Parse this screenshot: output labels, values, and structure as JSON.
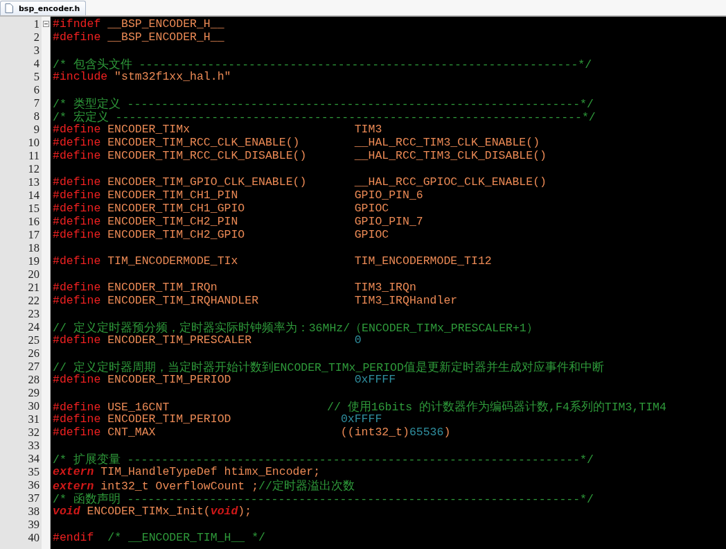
{
  "tab": {
    "label": "bsp_encoder.h",
    "selected": true
  },
  "lines": [
    {
      "number": "1",
      "fold_start": true,
      "tokens": [
        {
          "kind": "pp",
          "text": "#ifndef"
        },
        {
          "kind": "id",
          "text": " __BSP_ENCODER_H__"
        }
      ]
    },
    {
      "number": "2",
      "fold_start": false,
      "tokens": [
        {
          "kind": "pp",
          "text": "#define"
        },
        {
          "kind": "id",
          "text": " __BSP_ENCODER_H__"
        }
      ]
    },
    {
      "number": "3",
      "fold_start": false
    },
    {
      "number": "4",
      "fold_start": false,
      "tokens": [
        {
          "kind": "cm",
          "text": "/* 包含头文件 ----------------------------------------------------------------*/"
        }
      ]
    },
    {
      "number": "5",
      "fold_start": false,
      "tokens": [
        {
          "kind": "pp",
          "text": "#include"
        },
        {
          "kind": "id",
          "text": " \"stm32f1xx_hal.h\""
        }
      ]
    },
    {
      "number": "6",
      "fold_start": false
    },
    {
      "number": "7",
      "fold_start": false,
      "tokens": [
        {
          "kind": "cm",
          "text": "/* 类型定义 ------------------------------------------------------------------*/"
        }
      ]
    },
    {
      "number": "8",
      "fold_start": false,
      "tokens": [
        {
          "kind": "cm",
          "text": "/* 宏定义 --------------------------------------------------------------------*/"
        }
      ]
    },
    {
      "number": "9",
      "fold_start": false,
      "tokens": [
        {
          "kind": "pp",
          "text": "#define"
        },
        {
          "kind": "id",
          "text": " ENCODER_TIMx                        "
        },
        {
          "kind": "id",
          "text": "TIM3"
        }
      ]
    },
    {
      "number": "10",
      "fold_start": false,
      "tokens": [
        {
          "kind": "pp",
          "text": "#define"
        },
        {
          "kind": "id",
          "text": " ENCODER_TIM_RCC_CLK_ENABLE()        "
        },
        {
          "kind": "id",
          "text": "__HAL_RCC_TIM3_CLK_ENABLE()"
        }
      ]
    },
    {
      "number": "11",
      "fold_start": false,
      "tokens": [
        {
          "kind": "pp",
          "text": "#define"
        },
        {
          "kind": "id",
          "text": " ENCODER_TIM_RCC_CLK_DISABLE()       "
        },
        {
          "kind": "id",
          "text": "__HAL_RCC_TIM3_CLK_DISABLE()"
        }
      ]
    },
    {
      "number": "12",
      "fold_start": false
    },
    {
      "number": "13",
      "fold_start": false,
      "tokens": [
        {
          "kind": "pp",
          "text": "#define"
        },
        {
          "kind": "id",
          "text": " ENCODER_TIM_GPIO_CLK_ENABLE()       "
        },
        {
          "kind": "id",
          "text": "__HAL_RCC_GPIOC_CLK_ENABLE()"
        }
      ]
    },
    {
      "number": "14",
      "fold_start": false,
      "tokens": [
        {
          "kind": "pp",
          "text": "#define"
        },
        {
          "kind": "id",
          "text": " ENCODER_TIM_CH1_PIN                 "
        },
        {
          "kind": "id",
          "text": "GPIO_PIN_6"
        }
      ]
    },
    {
      "number": "15",
      "fold_start": false,
      "tokens": [
        {
          "kind": "pp",
          "text": "#define"
        },
        {
          "kind": "id",
          "text": " ENCODER_TIM_CH1_GPIO                "
        },
        {
          "kind": "id",
          "text": "GPIOC"
        }
      ]
    },
    {
      "number": "16",
      "fold_start": false,
      "tokens": [
        {
          "kind": "pp",
          "text": "#define"
        },
        {
          "kind": "id",
          "text": " ENCODER_TIM_CH2_PIN                 "
        },
        {
          "kind": "id",
          "text": "GPIO_PIN_7"
        }
      ]
    },
    {
      "number": "17",
      "fold_start": false,
      "tokens": [
        {
          "kind": "pp",
          "text": "#define"
        },
        {
          "kind": "id",
          "text": " ENCODER_TIM_CH2_GPIO                "
        },
        {
          "kind": "id",
          "text": "GPIOC"
        }
      ]
    },
    {
      "number": "18",
      "fold_start": false
    },
    {
      "number": "19",
      "fold_start": false,
      "tokens": [
        {
          "kind": "pp",
          "text": "#define"
        },
        {
          "kind": "id",
          "text": " TIM_ENCODERMODE_TIx                 "
        },
        {
          "kind": "id",
          "text": "TIM_ENCODERMODE_TI12"
        }
      ]
    },
    {
      "number": "20",
      "fold_start": false
    },
    {
      "number": "21",
      "fold_start": false,
      "tokens": [
        {
          "kind": "pp",
          "text": "#define"
        },
        {
          "kind": "id",
          "text": " ENCODER_TIM_IRQn                    "
        },
        {
          "kind": "id",
          "text": "TIM3_IRQn"
        }
      ]
    },
    {
      "number": "22",
      "fold_start": false,
      "tokens": [
        {
          "kind": "pp",
          "text": "#define"
        },
        {
          "kind": "id",
          "text": " ENCODER_TIM_IRQHANDLER              "
        },
        {
          "kind": "id",
          "text": "TIM3_IRQHandler"
        }
      ]
    },
    {
      "number": "23",
      "fold_start": false
    },
    {
      "number": "24",
      "fold_start": false,
      "tokens": [
        {
          "kind": "cm",
          "text": "// 定义定时器预分频，定时器实际时钟频率为：36MHz/（ENCODER_TIMx_PRESCALER+1）"
        }
      ]
    },
    {
      "number": "25",
      "fold_start": false,
      "tokens": [
        {
          "kind": "pp",
          "text": "#define"
        },
        {
          "kind": "id",
          "text": " ENCODER_TIM_PRESCALER               "
        },
        {
          "kind": "num",
          "text": "0"
        }
      ]
    },
    {
      "number": "26",
      "fold_start": false
    },
    {
      "number": "27",
      "fold_start": false,
      "tokens": [
        {
          "kind": "cm",
          "text": "// 定义定时器周期，当定时器开始计数到ENCODER_TIMx_PERIOD值是更新定时器并生成对应事件和中断"
        }
      ]
    },
    {
      "number": "28",
      "fold_start": false,
      "tokens": [
        {
          "kind": "pp",
          "text": "#define"
        },
        {
          "kind": "id",
          "text": " ENCODER_TIM_PERIOD                  "
        },
        {
          "kind": "num",
          "text": "0xFFFF"
        }
      ]
    },
    {
      "number": "29",
      "fold_start": false
    },
    {
      "number": "30",
      "fold_start": false,
      "tokens": [
        {
          "kind": "pp",
          "text": "#define"
        },
        {
          "kind": "id",
          "text": " USE_16CNT                       "
        },
        {
          "kind": "cm",
          "text": "// 使用16bits 的计数器作为编码器计数,F4系列的TIM3,TIM4"
        }
      ]
    },
    {
      "number": "31",
      "fold_start": false,
      "tokens": [
        {
          "kind": "pp",
          "text": "#define"
        },
        {
          "kind": "id",
          "text": " ENCODER_TIM_PERIOD                "
        },
        {
          "kind": "num",
          "text": "0xFFFF"
        }
      ]
    },
    {
      "number": "32",
      "fold_start": false,
      "tokens": [
        {
          "kind": "pp",
          "text": "#define"
        },
        {
          "kind": "id",
          "text": " CNT_MAX                           ((int32_t)"
        },
        {
          "kind": "num",
          "text": "65536"
        },
        {
          "kind": "id",
          "text": ")"
        }
      ]
    },
    {
      "number": "33",
      "fold_start": false
    },
    {
      "number": "34",
      "fold_start": false,
      "tokens": [
        {
          "kind": "cm",
          "text": "/* 扩展变量 ------------------------------------------------------------------*/"
        }
      ]
    },
    {
      "number": "35",
      "fold_start": false,
      "tokens": [
        {
          "kind": "kw",
          "text": "extern"
        },
        {
          "kind": "id",
          "text": " TIM_HandleTypeDef htimx_Encoder;"
        }
      ]
    },
    {
      "number": "36",
      "fold_start": false,
      "tokens": [
        {
          "kind": "kw",
          "text": "extern"
        },
        {
          "kind": "id",
          "text": " int32_t OverflowCount ;"
        },
        {
          "kind": "cm",
          "text": "//定时器溢出次数"
        }
      ]
    },
    {
      "number": "37",
      "fold_start": false,
      "tokens": [
        {
          "kind": "cm",
          "text": "/* 函数声明 ------------------------------------------------------------------*/"
        }
      ]
    },
    {
      "number": "38",
      "fold_start": false,
      "tokens": [
        {
          "kind": "kw",
          "text": "void"
        },
        {
          "kind": "id",
          "text": " ENCODER_TIMx_Init("
        },
        {
          "kind": "kw",
          "text": "void"
        },
        {
          "kind": "id",
          "text": ");"
        }
      ]
    },
    {
      "number": "39",
      "fold_start": false
    },
    {
      "number": "40",
      "fold_start": false,
      "tokens": [
        {
          "kind": "pp",
          "text": "#endif"
        },
        {
          "kind": "cm",
          "text": "  /* __ENCODER_TIM_H__ */"
        }
      ]
    }
  ]
}
